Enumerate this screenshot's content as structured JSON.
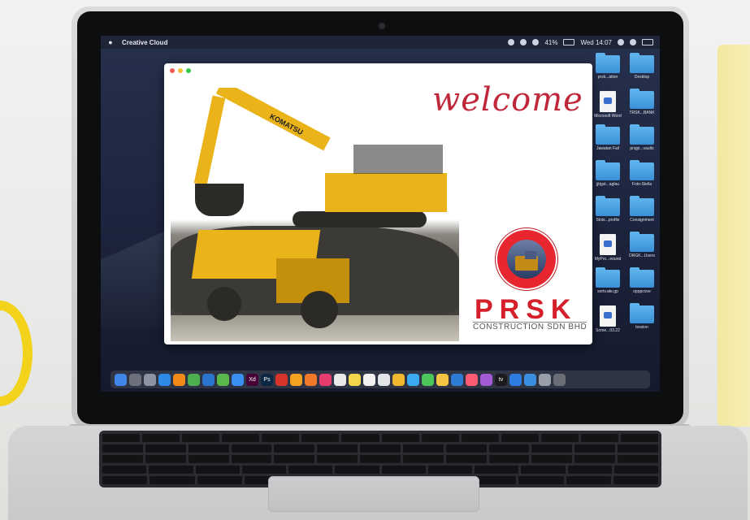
{
  "menubar": {
    "app_name": "Creative Cloud",
    "battery": "41%",
    "clock": "Wed 14:07"
  },
  "window": {
    "welcome_text": "welcome",
    "brand_name": "PRSK",
    "brand_subtitle": "CONSTRUCTION SDN BHD",
    "excavator_brand": "KOMATSU"
  },
  "desktop": {
    "items": [
      {
        "label": "prsk...ation",
        "kind": "folder"
      },
      {
        "label": "Desktop",
        "kind": "folder"
      },
      {
        "label": "Microsoft Word",
        "kind": "doc"
      },
      {
        "label": "TRSK...BANK",
        "kind": "folder"
      },
      {
        "label": "Jawatan Fail",
        "kind": "folder"
      },
      {
        "label": "prsjpi...vaults",
        "kind": "folder"
      },
      {
        "label": "jjttgst...aglau",
        "kind": "folder"
      },
      {
        "label": "Foto-Stella",
        "kind": "folder"
      },
      {
        "label": "Slots...profile",
        "kind": "folder"
      },
      {
        "label": "Consignment",
        "kind": "folder"
      },
      {
        "label": "MyPro...eound",
        "kind": "doc"
      },
      {
        "label": "DRGK...Users",
        "kind": "folder"
      },
      {
        "label": "sortv.ate.gp",
        "kind": "folder"
      },
      {
        "label": "opppcove",
        "kind": "folder"
      },
      {
        "label": "Scree...03.22",
        "kind": "doc"
      },
      {
        "label": "lession",
        "kind": "folder"
      }
    ]
  },
  "dock": {
    "apps": [
      {
        "label": "",
        "color": "#3f86e8"
      },
      {
        "label": "",
        "color": "#6d6f7a"
      },
      {
        "label": "",
        "color": "#8d93a1"
      },
      {
        "label": "",
        "color": "#2d8ae6"
      },
      {
        "label": "",
        "color": "#f28a18"
      },
      {
        "label": "",
        "color": "#4db050"
      },
      {
        "label": "",
        "color": "#2c75cf"
      },
      {
        "label": "",
        "color": "#58b84b"
      },
      {
        "label": "",
        "color": "#3b8ff0"
      },
      {
        "label": "Xd",
        "color": "#470137"
      },
      {
        "label": "Ps",
        "color": "#0c2743"
      },
      {
        "label": "",
        "color": "#d9342b"
      },
      {
        "label": "",
        "color": "#f3a321"
      },
      {
        "label": "",
        "color": "#f07a2a"
      },
      {
        "label": "",
        "color": "#e63c6d"
      },
      {
        "label": "",
        "color": "#e9e9ea"
      },
      {
        "label": "",
        "color": "#f4d64b"
      },
      {
        "label": "",
        "color": "#f1f1f1"
      },
      {
        "label": "",
        "color": "#e3e4e8"
      },
      {
        "label": "",
        "color": "#f0b72f"
      },
      {
        "label": "",
        "color": "#3baaf3"
      },
      {
        "label": "",
        "color": "#4cc55a"
      },
      {
        "label": "",
        "color": "#f4c542"
      },
      {
        "label": "",
        "color": "#2e7cd6"
      },
      {
        "label": "",
        "color": "#fb5c74"
      },
      {
        "label": "",
        "color": "#a35bd6"
      },
      {
        "label": "tv",
        "color": "#1b1b1d"
      },
      {
        "label": "",
        "color": "#2f7de1"
      },
      {
        "label": "",
        "color": "#3a8fe0"
      },
      {
        "label": "",
        "color": "#9a9ea8"
      },
      {
        "label": "",
        "color": "#6b6e77"
      }
    ]
  }
}
